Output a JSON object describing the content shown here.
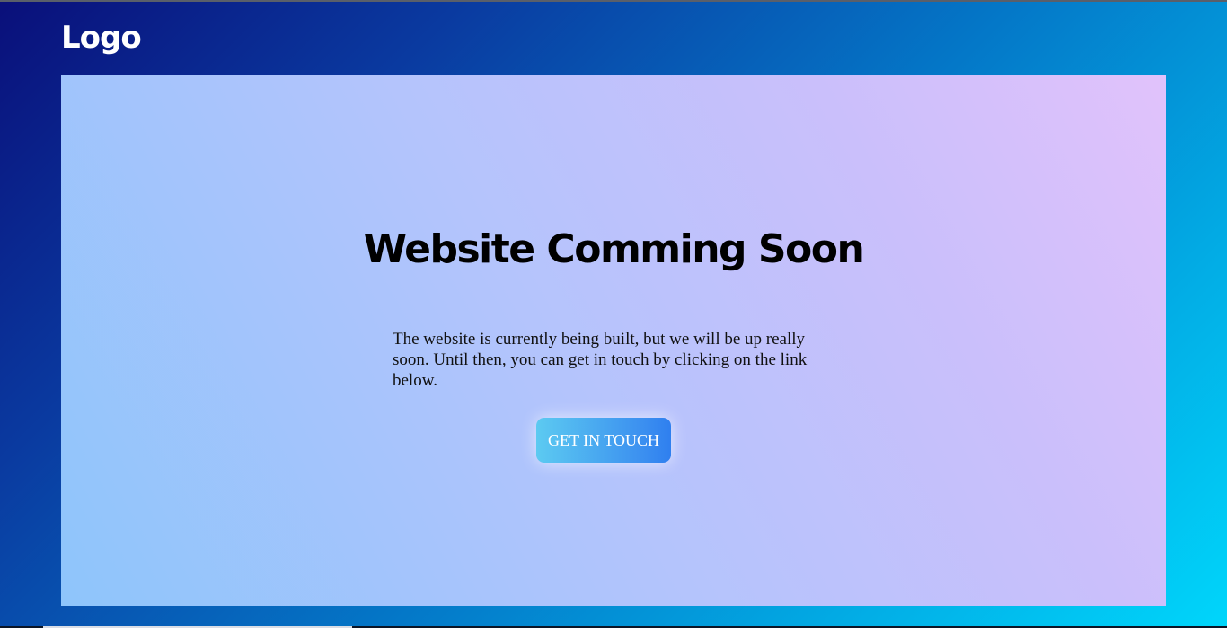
{
  "header": {
    "logo_text": "Logo"
  },
  "main": {
    "headline": "Website Comming Soon",
    "message": "The website is currently being built, but we will be up really soon. Until then, you can get in touch by clicking on the link below.",
    "cta_label": "GET IN TOUCH"
  },
  "colors": {
    "background_gradient": [
      "#0a0f7a",
      "#0478c8",
      "#00d6fb"
    ],
    "card_gradient": [
      "#8ec5fb",
      "#b4c4fc",
      "#e1c2fb"
    ],
    "button_gradient": [
      "#5ccaf1",
      "#2f7fef"
    ],
    "text": "#000000",
    "logo": "#ffffff"
  }
}
